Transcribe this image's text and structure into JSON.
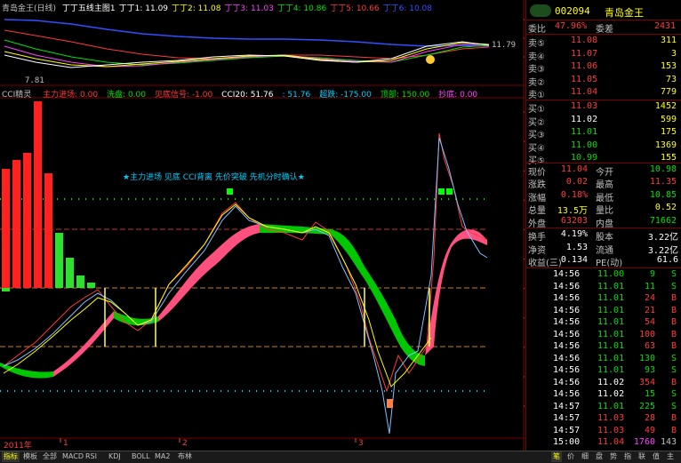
{
  "main_header": {
    "title": "青岛金王(日线)",
    "ma_items": [
      {
        "label": "丁丁五线主图1",
        "color": "#ffffff"
      },
      {
        "label": "丁丁1: 11.09",
        "color": "#ffffff"
      },
      {
        "label": "丁丁2: 11.08",
        "color": "#ffff00"
      },
      {
        "label": "丁丁3: 11.03",
        "color": "#ff40ff"
      },
      {
        "label": "丁丁4: 10.86",
        "color": "#00e000"
      },
      {
        "label": "丁丁5: 10.66",
        "color": "#ff3b3b"
      },
      {
        "label": "丁丁6: 10.08",
        "color": "#3050ff"
      }
    ],
    "high_label": "11.79",
    "low_label": "7.81",
    "y_ticks": [
      "14.00",
      "12.00",
      "10.00"
    ]
  },
  "indicator_header": {
    "name": "CCI精灵",
    "items": [
      {
        "label": "主力进场: 0.00",
        "color": "#ff3b3b"
      },
      {
        "label": "洗盘: 0.00",
        "color": "#00e000"
      },
      {
        "label": "见底信号: -1.00",
        "color": "#ff3b3b"
      },
      {
        "label": "CCI20: 51.76",
        "color": "#ffffff"
      },
      {
        "label": ": 51.76",
        "color": "#00d0ff"
      },
      {
        "label": "超跌: -175.00",
        "color": "#00d0ff"
      },
      {
        "label": "顶部: 150.00",
        "color": "#00e000"
      },
      {
        "label": "抄底: 0.00",
        "color": "#ff40ff"
      }
    ],
    "annotation": "★主力进场 见底 CCI背离 先价突破 先机分时确认★",
    "y_ticks": [
      "300.00",
      "250.00",
      "200.00",
      "150.00",
      "100.00",
      "50.00",
      "0.00",
      "-50.00",
      "-100.00",
      "-150.00",
      "-200.00"
    ]
  },
  "x_axis": {
    "labels": [
      "2011年",
      "1",
      "2",
      "3"
    ],
    "period": "日线"
  },
  "quote": {
    "code": "002094",
    "name": "青岛金王",
    "wei_bi_label": "委比",
    "wei_bi": "47.96%",
    "wei_cha_label": "委差",
    "wei_cha": "2431",
    "sells": [
      {
        "label": "卖⑤",
        "price": "11.08",
        "vol": "311",
        "color": "#ff3b3b"
      },
      {
        "label": "卖④",
        "price": "11.07",
        "vol": "3",
        "color": "#ff3b3b"
      },
      {
        "label": "卖③",
        "price": "11.06",
        "vol": "153",
        "color": "#ff3b3b"
      },
      {
        "label": "卖②",
        "price": "11.05",
        "vol": "73",
        "color": "#ff3b3b"
      },
      {
        "label": "卖①",
        "price": "11.04",
        "vol": "779",
        "color": "#ff3b3b"
      }
    ],
    "buys": [
      {
        "label": "买①",
        "price": "11.03",
        "vol": "1452",
        "color": "#ff3b3b"
      },
      {
        "label": "买②",
        "price": "11.02",
        "vol": "599",
        "color": "#ffffff"
      },
      {
        "label": "买③",
        "price": "11.01",
        "vol": "175",
        "color": "#00e000"
      },
      {
        "label": "买④",
        "price": "11.00",
        "vol": "1369",
        "color": "#00e000"
      },
      {
        "label": "买⑤",
        "price": "10.99",
        "vol": "155",
        "color": "#00e000"
      }
    ],
    "stats": [
      {
        "l1": "现价",
        "v1": "11.04",
        "c1": "#ff3b3b",
        "l2": "今开",
        "v2": "10.98",
        "c2": "#00e000"
      },
      {
        "l1": "涨跌",
        "v1": "0.02",
        "c1": "#ff3b3b",
        "l2": "最高",
        "v2": "11.35",
        "c2": "#ff3b3b"
      },
      {
        "l1": "涨幅",
        "v1": "0.18%",
        "c1": "#ff3b3b",
        "l2": "最低",
        "v2": "10.85",
        "c2": "#00e000"
      },
      {
        "l1": "总量",
        "v1": "13.5万",
        "c1": "#ffff00",
        "l2": "量比",
        "v2": "0.52",
        "c2": "#ffff00"
      },
      {
        "l1": "外盘",
        "v1": "63203",
        "c1": "#ff3b3b",
        "l2": "内盘",
        "v2": "71662",
        "c2": "#00e000"
      }
    ],
    "finance": [
      {
        "l1": "换手",
        "v1": "4.19%",
        "l2": "股本",
        "v2": "3.22亿"
      },
      {
        "l1": "净资",
        "v1": "1.53",
        "l2": "流通",
        "v2": "3.22亿"
      },
      {
        "l1": "收益(三)",
        "v1": "0.134",
        "l2": "PE(动)",
        "v2": "61.6"
      }
    ],
    "ticks": [
      {
        "t": "14:56",
        "p": "11.00",
        "pc": "#00e000",
        "v": "9",
        "f": "S"
      },
      {
        "t": "14:56",
        "p": "11.01",
        "pc": "#00e000",
        "v": "11",
        "f": "S"
      },
      {
        "t": "14:56",
        "p": "11.01",
        "pc": "#00e000",
        "v": "24",
        "f": "B"
      },
      {
        "t": "14:56",
        "p": "11.01",
        "pc": "#00e000",
        "v": "21",
        "f": "B"
      },
      {
        "t": "14:56",
        "p": "11.01",
        "pc": "#00e000",
        "v": "54",
        "f": "B"
      },
      {
        "t": "14:56",
        "p": "11.01",
        "pc": "#00e000",
        "v": "100",
        "f": "B"
      },
      {
        "t": "14:56",
        "p": "11.01",
        "pc": "#00e000",
        "v": "63",
        "f": "B"
      },
      {
        "t": "14:56",
        "p": "11.01",
        "pc": "#00e000",
        "v": "130",
        "f": "S"
      },
      {
        "t": "14:56",
        "p": "11.01",
        "pc": "#00e000",
        "v": "93",
        "f": "S"
      },
      {
        "t": "14:56",
        "p": "11.02",
        "pc": "#ffffff",
        "v": "354",
        "f": "B"
      },
      {
        "t": "14:56",
        "p": "11.02",
        "pc": "#ffffff",
        "v": "15",
        "f": "S"
      },
      {
        "t": "14:57",
        "p": "11.01",
        "pc": "#00e000",
        "v": "225",
        "f": "S"
      },
      {
        "t": "14:57",
        "p": "11.03",
        "pc": "#ff3b3b",
        "v": "28",
        "f": "B"
      },
      {
        "t": "14:57",
        "p": "11.03",
        "pc": "#ff3b3b",
        "v": "49",
        "f": "B"
      },
      {
        "t": "15:00",
        "p": "11.04",
        "pc": "#ff3b3b",
        "v": "1760",
        "f": "143"
      }
    ]
  },
  "tabs": {
    "left": [
      "指标",
      "模板",
      "全部",
      "MACD",
      "RSI",
      "KDJ",
      "BOLL",
      "MA2",
      "布林"
    ],
    "right": [
      "笔",
      "价",
      "细",
      "盘",
      "势",
      "指",
      "联",
      "值",
      "主"
    ]
  }
}
